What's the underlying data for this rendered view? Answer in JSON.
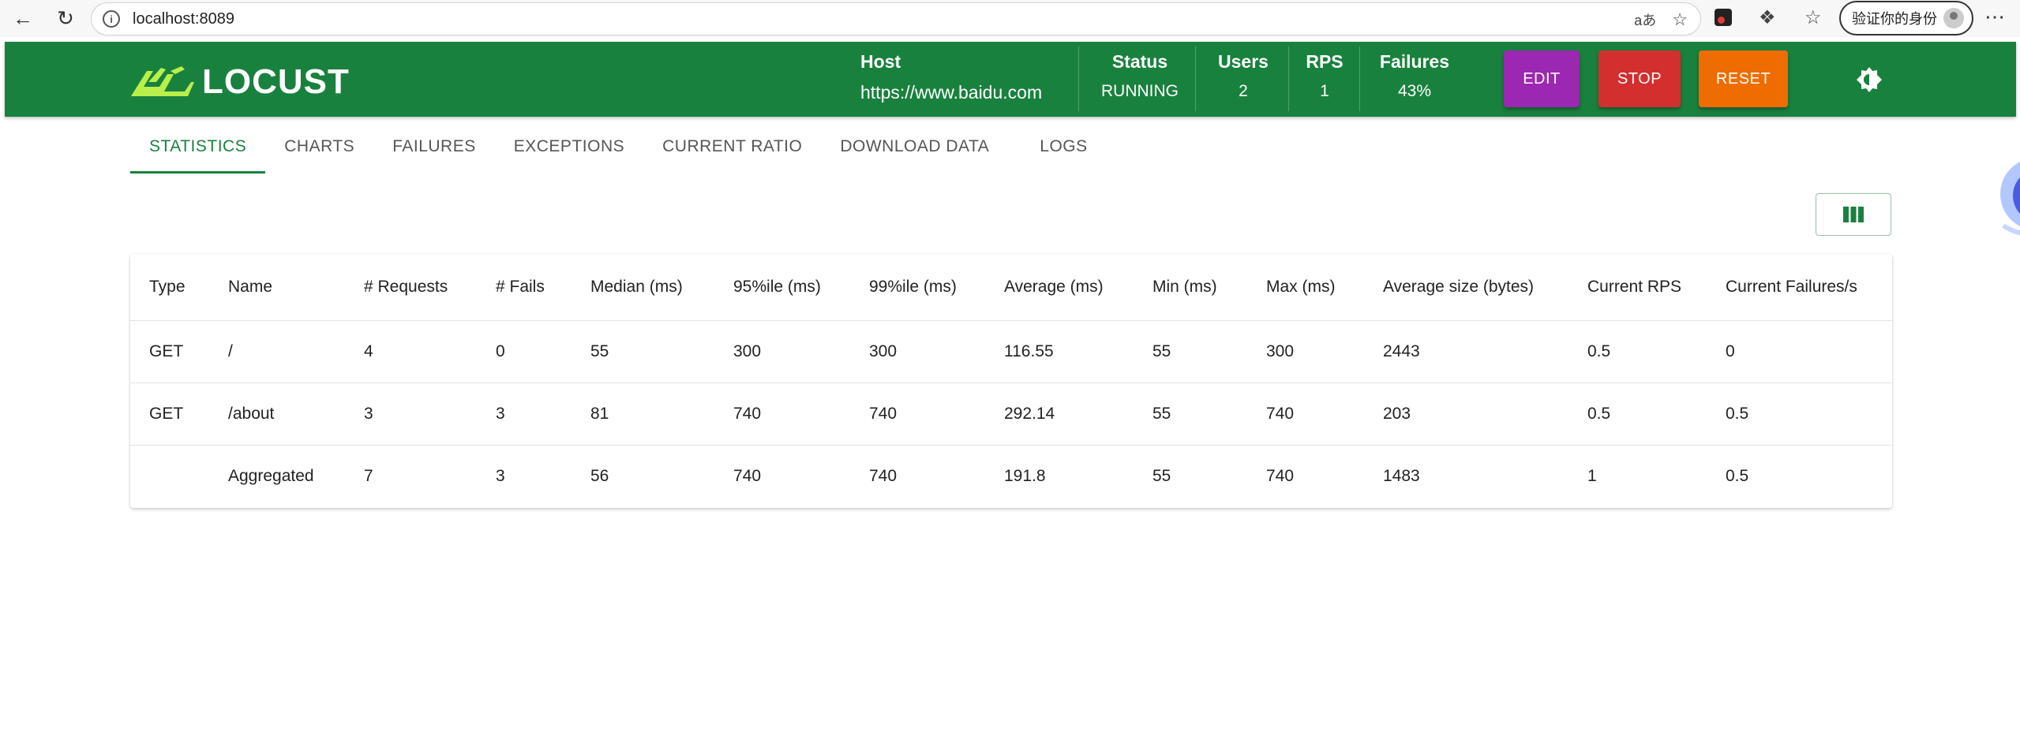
{
  "browser": {
    "url": "localhost:8089",
    "profile_label": "验证你的身份"
  },
  "header": {
    "logo_text": "LOCUST",
    "stats": [
      {
        "label": "Host",
        "value": "https://www.baidu.com"
      },
      {
        "label": "Status",
        "value": "RUNNING"
      },
      {
        "label": "Users",
        "value": "2"
      },
      {
        "label": "RPS",
        "value": "1"
      },
      {
        "label": "Failures",
        "value": "43%"
      }
    ],
    "buttons": {
      "edit": "EDIT",
      "stop": "STOP",
      "reset": "RESET"
    },
    "colors": {
      "header": "#19813e",
      "edit": "#9c27b0",
      "stop": "#d32f2f",
      "reset": "#ef6c00"
    }
  },
  "tabs": [
    "STATISTICS",
    "CHARTS",
    "FAILURES",
    "EXCEPTIONS",
    "CURRENT RATIO",
    "DOWNLOAD DATA",
    "LOGS"
  ],
  "active_tab": "STATISTICS",
  "table": {
    "columns": [
      "Type",
      "Name",
      "# Requests",
      "# Fails",
      "Median (ms)",
      "95%ile (ms)",
      "99%ile (ms)",
      "Average (ms)",
      "Min (ms)",
      "Max (ms)",
      "Average size (bytes)",
      "Current RPS",
      "Current Failures/s"
    ],
    "rows": [
      [
        "GET",
        "/",
        "4",
        "0",
        "55",
        "300",
        "300",
        "116.55",
        "55",
        "300",
        "2443",
        "0.5",
        "0"
      ],
      [
        "GET",
        "/about",
        "3",
        "3",
        "81",
        "740",
        "740",
        "292.14",
        "55",
        "740",
        "203",
        "0.5",
        "0.5"
      ],
      [
        "",
        "Aggregated",
        "7",
        "3",
        "56",
        "740",
        "740",
        "191.8",
        "55",
        "740",
        "1483",
        "1",
        "0.5"
      ]
    ]
  }
}
